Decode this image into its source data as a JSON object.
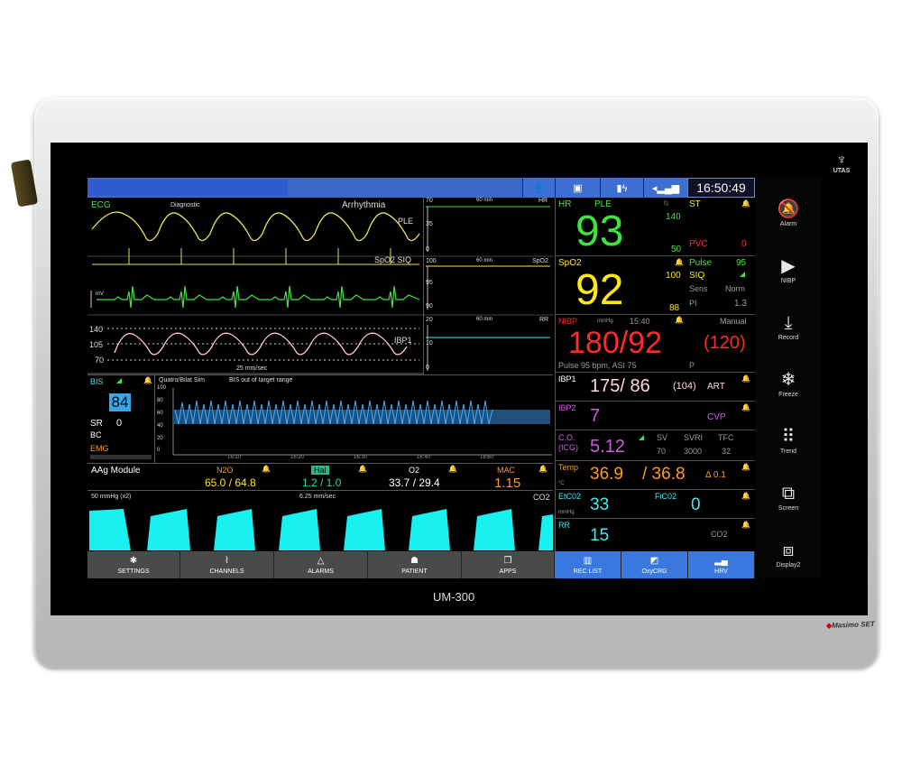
{
  "device": {
    "model": "UM-300",
    "logo_text": "UTAS",
    "masimo": "Masimo SET"
  },
  "topbar": {
    "clock": "16:50:49"
  },
  "sidebar": [
    {
      "label": "Alarm",
      "icon": "alarm-off-icon"
    },
    {
      "label": "NIBP",
      "icon": "play-icon"
    },
    {
      "label": "Record",
      "icon": "record-icon"
    },
    {
      "label": "Freeze",
      "icon": "snowflake-icon"
    },
    {
      "label": "Trend",
      "icon": "grid-icon"
    },
    {
      "label": "Screen",
      "icon": "screen-icon"
    },
    {
      "label": "Display2",
      "icon": "display-icon"
    }
  ],
  "waves": {
    "ecg_label": "ECG",
    "diagnostic": "Diagnostic",
    "arrhythmia": "Arrhythmia",
    "ple": "PLE",
    "spo2_siq": "SpO2 SIQ",
    "mv": "mV",
    "ibp1": "IBP1",
    "scale_140": "140",
    "scale_105": "105",
    "scale_70": "70",
    "speed": "25 mm/sec"
  },
  "trends": [
    {
      "top": "70",
      "mid": "35",
      "bot": "0",
      "span": "60 min",
      "label": "HR"
    },
    {
      "top": "100",
      "mid": "95",
      "bot": "90",
      "span": "60 min",
      "label": "SpO2"
    },
    {
      "top": "20",
      "mid": "10",
      "bot": "0",
      "span": "60 min",
      "label": "RR"
    }
  ],
  "hr": {
    "label": "HR",
    "ple": "PLE",
    "value": "93",
    "upper": "140",
    "lower": "50"
  },
  "st": {
    "label": "ST",
    "pvc_label": "PVC",
    "pvc": "0"
  },
  "spo2": {
    "label": "SpO2",
    "value": "92",
    "upper": "100",
    "lower": "88"
  },
  "pulse": {
    "label": "Pulse",
    "value": "95",
    "siq": "SIQ",
    "sens": "Sens",
    "norm": "Norm",
    "pi_label": "PI",
    "pi": "1.3"
  },
  "nibp": {
    "label": "NIBP",
    "unit": "mmHg",
    "time": "15:40",
    "mode": "Manual",
    "value": "180/92",
    "mean": "(120)",
    "pulse_line": "Pulse 95 bpm, ASI 75",
    "p": "P"
  },
  "ibp1": {
    "label": "IBP1",
    "value": "175/ 86",
    "mean": "(104)",
    "site": "ART"
  },
  "ibp2": {
    "label": "IBP2",
    "value": "7",
    "site": "CVP"
  },
  "co": {
    "label": "C.O.",
    "label2": "(ICG)",
    "value": "5.12",
    "sv_l": "SV",
    "svri_l": "SVRI",
    "tfc_l": "TFC",
    "sv": "70",
    "svri": "3000",
    "tfc": "32"
  },
  "temp": {
    "label": "Temp",
    "unit": "°C",
    "value": "36.9",
    "value2": "/ 36.8",
    "delta": "Δ 0.1"
  },
  "etco2": {
    "label": "EtC02",
    "unit": "mmHg",
    "value": "33",
    "fi_label": "FiC02",
    "fi": "0"
  },
  "rr": {
    "label": "RR",
    "value": "15",
    "src": "CO2"
  },
  "bis": {
    "label": "BIS",
    "value": "84",
    "sr_l": "SR",
    "sr": "0",
    "bc": "BC",
    "emg": "EMG",
    "mode": "Quatro/Bilat Sim",
    "msg": "BIS out of target range",
    "y_ticks": [
      "100",
      "80",
      "60",
      "40",
      "20",
      "0"
    ],
    "x_ticks": [
      "16:10",
      "16:20",
      "16:30",
      "16:40",
      "16:50"
    ]
  },
  "aag": {
    "title": "AAg Module",
    "n2o_l": "N2O",
    "n2o": "65.0 / 64.8",
    "hal_l": "Hal",
    "hal": "1.2 / 1.0",
    "o2_l": "O2",
    "o2": "33.7 / 29.4",
    "mac_l": "MAC",
    "mac": "1.15"
  },
  "co2wave": {
    "scale": "50 mmHg (x2)",
    "speed": "6.25 mm/sec",
    "label": "CO2"
  },
  "bottom": [
    {
      "label": "SETTINGS",
      "icon": "gear-icon"
    },
    {
      "label": "CHANNELS",
      "icon": "pulse-icon"
    },
    {
      "label": "ALARMS",
      "icon": "alarm-icon"
    },
    {
      "label": "PATIENT",
      "icon": "patient-icon"
    },
    {
      "label": "APPS",
      "icon": "apps-icon"
    },
    {
      "label": "REC LIST",
      "icon": "list-icon"
    },
    {
      "label": "OxyCRG",
      "icon": "oxycrg-icon"
    },
    {
      "label": "HRV",
      "icon": "hrv-icon"
    }
  ]
}
